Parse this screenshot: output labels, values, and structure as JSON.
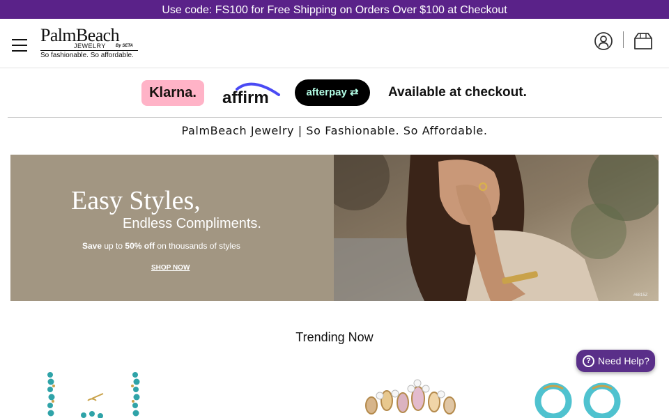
{
  "promo": {
    "text": "Use code: FS100 for Free Shipping on Orders Over $100 at Checkout"
  },
  "header": {
    "logo": {
      "name": "PalmBeach",
      "sub": "JEWELRY",
      "by": "By SETA",
      "tagline": "So fashionable. So affordable."
    },
    "icons": {
      "menu": "hamburger-menu-icon",
      "account": "account-icon",
      "bag": "shopping-bag-icon"
    }
  },
  "payments": {
    "klarna": "Klarna.",
    "affirm": "affirm",
    "afterpay": "afterpay",
    "message": "Available at checkout."
  },
  "tagline": "PalmBeach Jewelry | So Fashionable. So Affordable.",
  "hero": {
    "title": "Easy Styles,",
    "subtitle": "Endless Compliments.",
    "offer_pre": "Save",
    "offer_mid": " up to ",
    "offer_pct": "50% off",
    "offer_post": " on thousands of styles",
    "cta": "SHOP NOW",
    "item_code": "#6815Z"
  },
  "trending": {
    "title": "Trending Now"
  },
  "help": {
    "label": "Need Help?"
  },
  "colors": {
    "promo_bg": "#5a2289",
    "help_bg": "#5a2f89",
    "klarna_pink": "#ffb3c7",
    "affirm_blue": "#4a4af4",
    "afterpay_mint": "#b2fce4"
  }
}
